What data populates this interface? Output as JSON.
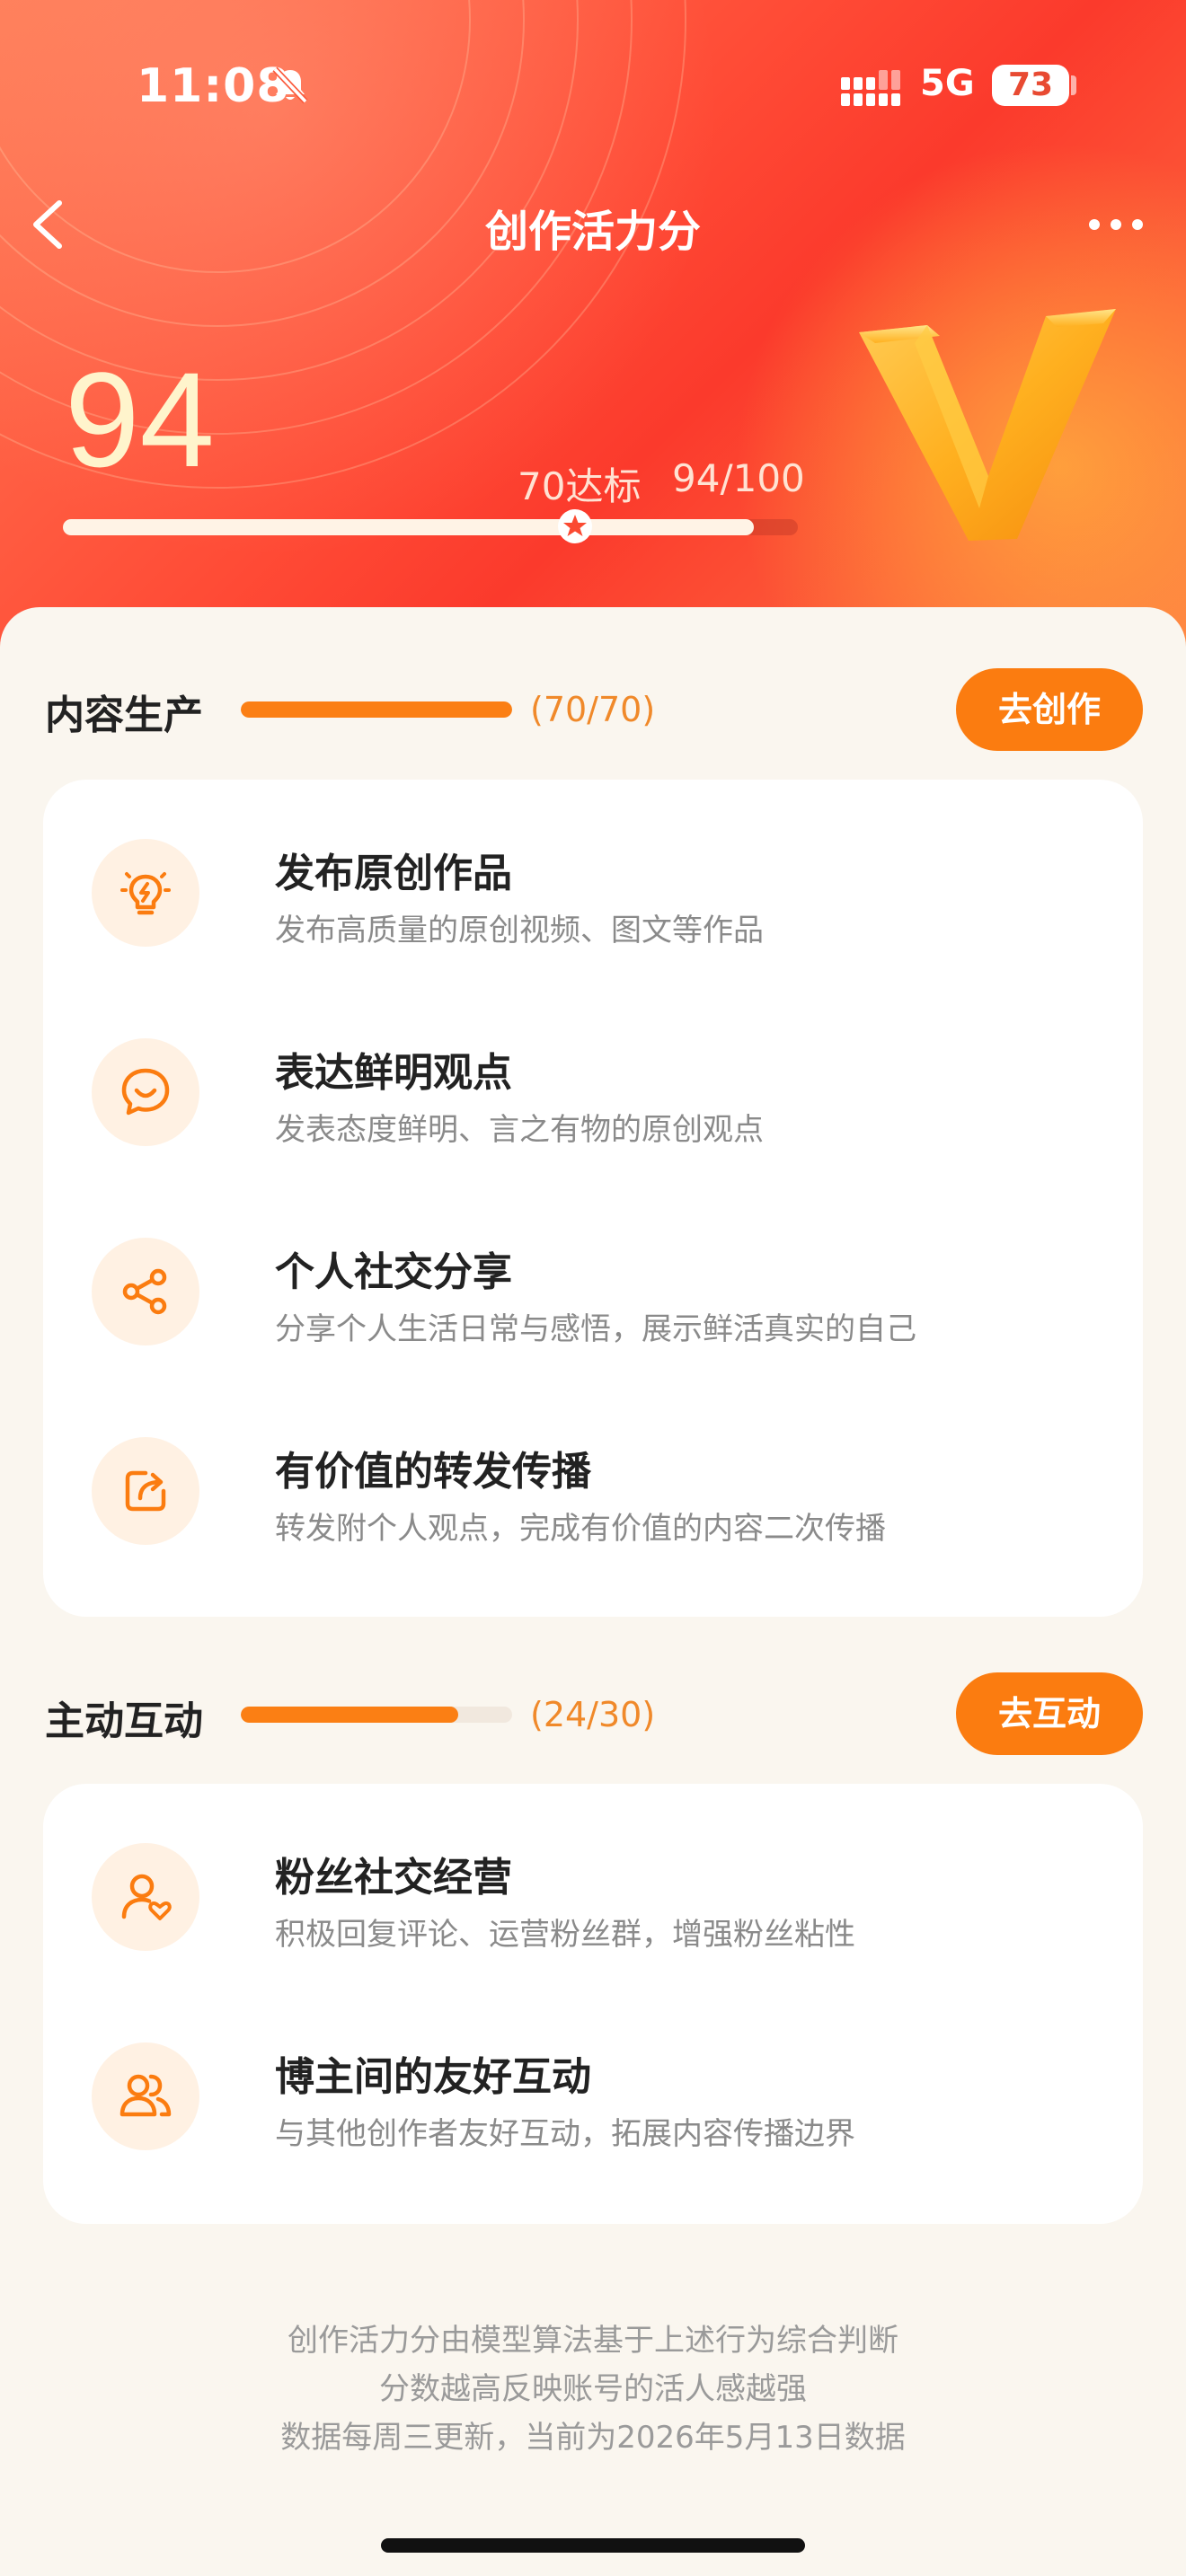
{
  "status_bar": {
    "time": "11:08",
    "network": "5G",
    "battery": "73",
    "icons": [
      "bell-off-icon",
      "signal-icon",
      "battery-icon"
    ]
  },
  "header": {
    "title": "创作活力分",
    "back_icon": "chevron-left-icon",
    "more_icon": "more-horizontal-icon"
  },
  "score": {
    "value": "94",
    "target_label": "70达标",
    "ratio_label": "94/100",
    "progress": 0.94,
    "target_progress": 0.7
  },
  "sections": [
    {
      "title": "内容生产",
      "count": "(70/70)",
      "progress": 1.0,
      "button": "去创作",
      "items": [
        {
          "icon": "lightbulb-icon",
          "title": "发布原创作品",
          "desc": "发布高质量的原创视频、图文等作品"
        },
        {
          "icon": "smile-chat-icon",
          "title": "表达鲜明观点",
          "desc": "发表态度鲜明、言之有物的原创观点"
        },
        {
          "icon": "share-icon",
          "title": "个人社交分享",
          "desc": "分享个人生活日常与感悟，展示鲜活真实的自己"
        },
        {
          "icon": "forward-icon",
          "title": "有价值的转发传播",
          "desc": "转发附个人观点，完成有价值的内容二次传播"
        }
      ]
    },
    {
      "title": "主动互动",
      "count": "(24/30)",
      "progress": 0.8,
      "button": "去互动",
      "items": [
        {
          "icon": "user-heart-icon",
          "title": "粉丝社交经营",
          "desc": "积极回复评论、运营粉丝群，增强粉丝粘性"
        },
        {
          "icon": "users-icon",
          "title": "博主间的友好互动",
          "desc": "与其他创作者友好互动，拓展内容传播边界"
        }
      ]
    }
  ],
  "footer": {
    "lines": [
      "创作活力分由模型算法基于上述行为综合判断",
      "分数越高反映账号的活人感越强",
      "数据每周三更新，当前为2026年5月13日数据"
    ]
  },
  "colors": {
    "accent": "#fb7c10",
    "hero_red": "#fb3a2c",
    "icon_bg": "#fff1e3",
    "page_bg": "#faf6ef"
  }
}
